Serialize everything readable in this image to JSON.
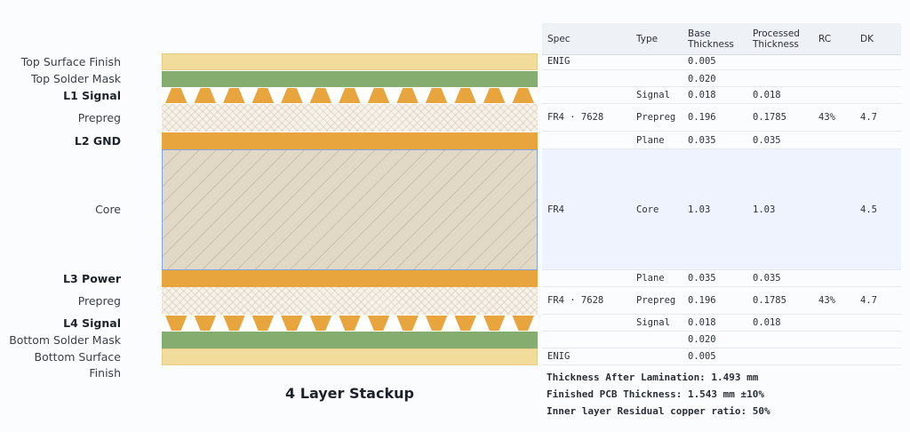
{
  "stackup": {
    "title": "4 Layer Stackup",
    "layers": [
      {
        "name": "Top Surface Finish",
        "kind": "finish",
        "bold": false
      },
      {
        "name": "Top Solder Mask",
        "kind": "mask",
        "bold": false
      },
      {
        "name": "L1 Signal",
        "kind": "signal",
        "bold": true
      },
      {
        "name": "Prepreg",
        "kind": "prepreg",
        "bold": false
      },
      {
        "name": "L2 GND",
        "kind": "plane",
        "bold": true
      },
      {
        "name": "Core",
        "kind": "core",
        "bold": false
      },
      {
        "name": "L3 Power",
        "kind": "plane",
        "bold": true
      },
      {
        "name": "Prepreg",
        "kind": "prepreg",
        "bold": false
      },
      {
        "name": "L4 Signal",
        "kind": "signal-bottom",
        "bold": true
      },
      {
        "name": "Bottom Solder Mask",
        "kind": "mask",
        "bold": false
      },
      {
        "name": "Bottom Surface Finish",
        "kind": "finish",
        "bold": false
      }
    ]
  },
  "table": {
    "headers": {
      "spec": "Spec",
      "type": "Type",
      "base_thickness": "Base Thickness",
      "processed_thickness": "Processed Thickness",
      "rc": "RC",
      "dk": "DK"
    },
    "rows": [
      {
        "spec": "ENIG",
        "type": "",
        "base": "0.005",
        "processed": "",
        "rc": "",
        "dk": ""
      },
      {
        "spec": "",
        "type": "",
        "base": "0.020",
        "processed": "",
        "rc": "",
        "dk": ""
      },
      {
        "spec": "",
        "type": "Signal",
        "base": "0.018",
        "processed": "0.018",
        "rc": "",
        "dk": ""
      },
      {
        "spec": "FR4 · 7628",
        "type": "Prepreg",
        "base": "0.196",
        "processed": "0.1785",
        "rc": "43%",
        "dk": "4.7"
      },
      {
        "spec": "",
        "type": "Plane",
        "base": "0.035",
        "processed": "0.035",
        "rc": "",
        "dk": ""
      },
      {
        "spec": "FR4",
        "type": "Core",
        "base": "1.03",
        "processed": "1.03",
        "rc": "",
        "dk": "4.5"
      },
      {
        "spec": "",
        "type": "Plane",
        "base": "0.035",
        "processed": "0.035",
        "rc": "",
        "dk": ""
      },
      {
        "spec": "FR4 · 7628",
        "type": "Prepreg",
        "base": "0.196",
        "processed": "0.1785",
        "rc": "43%",
        "dk": "4.7"
      },
      {
        "spec": "",
        "type": "Signal",
        "base": "0.018",
        "processed": "0.018",
        "rc": "",
        "dk": ""
      },
      {
        "spec": "",
        "type": "",
        "base": "0.020",
        "processed": "",
        "rc": "",
        "dk": ""
      },
      {
        "spec": "ENIG",
        "type": "",
        "base": "0.005",
        "processed": "",
        "rc": "",
        "dk": ""
      }
    ]
  },
  "summary": {
    "lamination": "Thickness After Lamination: 1.493 mm",
    "finished": "Finished PCB Thickness: 1.543 mm ±10%",
    "residual": "Inner layer Residual copper ratio: 50%"
  },
  "colors": {
    "finish": "#f2dc9c",
    "mask": "#84ad6f",
    "copper": "#e8a43d",
    "core_border": "#7fa6e6"
  }
}
